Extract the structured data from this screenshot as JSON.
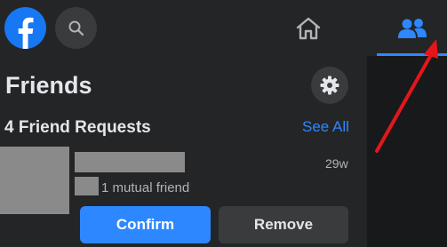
{
  "topbar": {
    "logo_icon": "facebook-logo-icon",
    "search_icon": "search-icon",
    "home_icon": "home-icon",
    "friends_icon": "friends-icon",
    "accent_color": "#2d88ff"
  },
  "panel": {
    "title": "Friends",
    "settings_icon": "gear-icon",
    "requests_heading": "4 Friend Requests",
    "see_all_label": "See All"
  },
  "request": {
    "time": "29w",
    "mutual_text": "1 mutual friend",
    "confirm_label": "Confirm",
    "remove_label": "Remove"
  },
  "annotation": {
    "color": "#e4161c"
  }
}
